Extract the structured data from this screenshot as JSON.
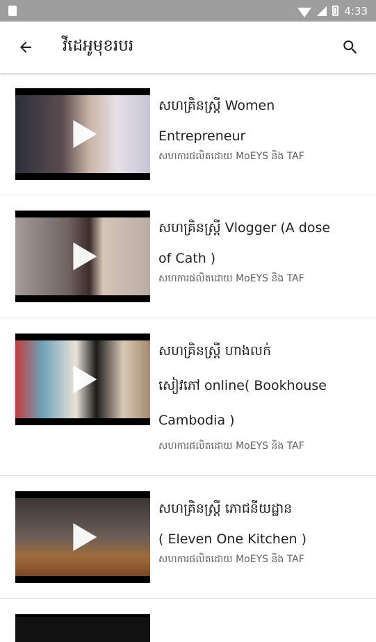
{
  "statusbar": {
    "time": "4:33"
  },
  "appbar": {
    "title": "វីដេអូមុខរបរ"
  },
  "videos": [
    {
      "title_line1": "សហគ្រិនស្ត្រី Women",
      "title_line2": "Entrepreneur",
      "title_line3": "",
      "subtitle": "សហការផលិតដោយ MoEYS និង TAF"
    },
    {
      "title_line1": "សហគ្រិនស្ត្រី Vlogger (A dose",
      "title_line2": "of Cath )",
      "title_line3": "",
      "subtitle": "សហការផលិតដោយ MoEYS និង TAF"
    },
    {
      "title_line1": "សហគ្រិនស្ត្រី ហាងលក់",
      "title_line2": "សៀវភៅ online( Bookhouse",
      "title_line3": "Cambodia )",
      "subtitle": "សហការផលិតដោយ MoEYS និង TAF"
    },
    {
      "title_line1": "សហគ្រិនស្ត្រី ភោជនីយដ្ឋាន",
      "title_line2": "( Eleven One Kitchen )",
      "title_line3": "",
      "subtitle": "សហការផលិតដោយ MoEYS និង TAF"
    }
  ],
  "colors": {
    "statusbar": "#9e9e9e",
    "appbar": "#ffffff",
    "divider": "#e6e6e6"
  }
}
